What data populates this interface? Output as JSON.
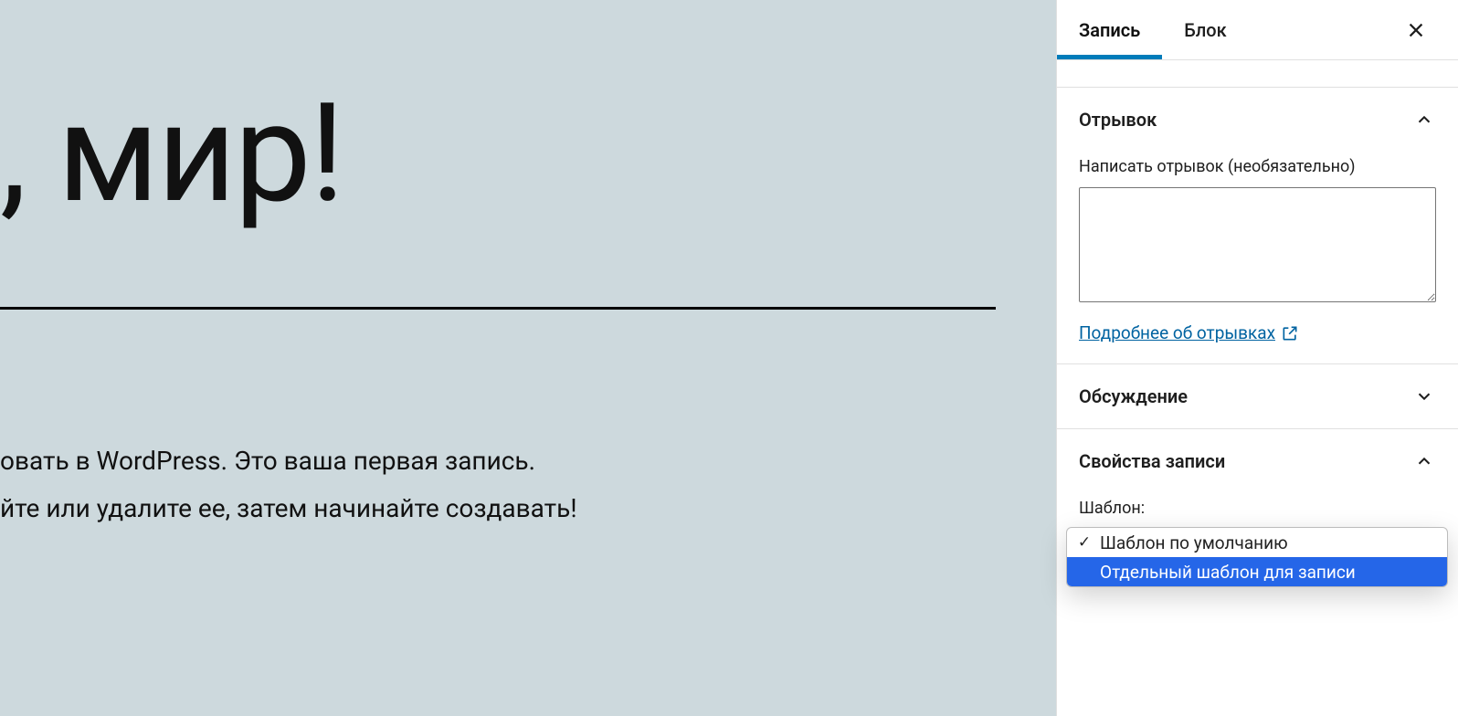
{
  "editor": {
    "title": ", мир!",
    "paragraph1": "овать в WordPress. Это ваша первая запись.",
    "paragraph2": "йте или удалите ее, затем начинайте создавать!"
  },
  "sidebar": {
    "tabs": {
      "post": "Запись",
      "block": "Блок"
    },
    "panels": {
      "excerpt": {
        "title": "Отрывок",
        "field_label": "Написать отрывок (необязательно)",
        "value": "",
        "learn_more": "Подробнее об отрывках"
      },
      "discussion": {
        "title": "Обсуждение"
      },
      "post_attributes": {
        "title": "Свойства записи",
        "template_label": "Шаблон:",
        "options": [
          {
            "label": "Шаблон по умолчанию",
            "checked": true,
            "selected": false
          },
          {
            "label": "Отдельный шаблон для записи",
            "checked": false,
            "selected": true
          }
        ]
      }
    }
  }
}
